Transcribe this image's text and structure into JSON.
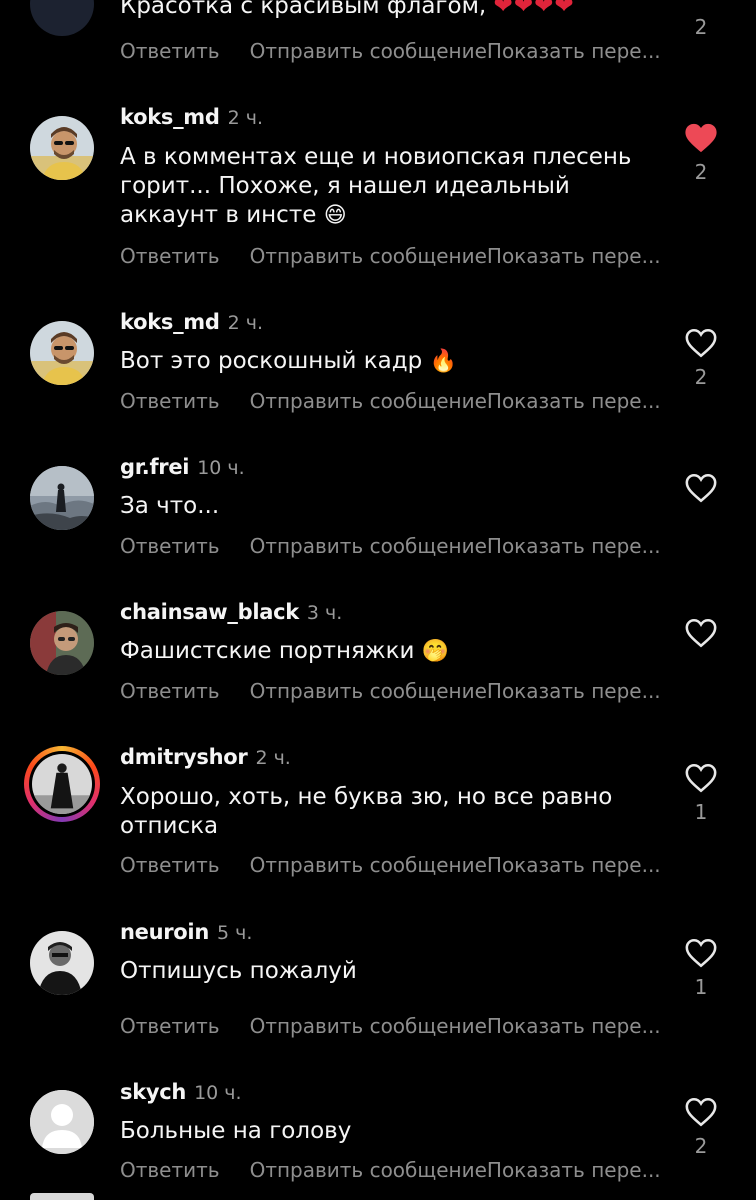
{
  "labels": {
    "reply": "Ответить",
    "send_message": "Отправить сообщение",
    "show_translation": "Показать пере..."
  },
  "colors": {
    "like_active": "#ed4956",
    "background": "#000000",
    "muted": "#8e8e8e"
  },
  "comments": [
    {
      "username": "",
      "time": "",
      "text": "Красотка с красивым флагом,",
      "emoji": "❤❤❤❤",
      "likes": "2",
      "liked": false
    },
    {
      "username": "koks_md",
      "time": "2 ч.",
      "text": "А в комментах еще и новиопская плесень горит... Похоже, я нашел идеальный аккаунт в инсте",
      "emoji": "😄",
      "likes": "2",
      "liked": true,
      "avatar_icon": "man-with-sunglasses-avatar"
    },
    {
      "username": "koks_md",
      "time": "2 ч.",
      "text": "Вот это роскошный кадр",
      "emoji": "🔥",
      "likes": "2",
      "liked": false,
      "avatar_icon": "man-with-sunglasses-avatar"
    },
    {
      "username": "gr.frei",
      "time": "10 ч.",
      "text": "За что...",
      "emoji": "",
      "likes": "",
      "liked": false,
      "avatar_icon": "wanderer-above-fog-avatar"
    },
    {
      "username": "chainsaw_black",
      "time": "3 ч.",
      "text": "Фашистские портняжки",
      "emoji": "🤭",
      "likes": "",
      "liked": false,
      "avatar_icon": "man-with-glasses-avatar"
    },
    {
      "username": "dmitryshor",
      "time": "2 ч.",
      "text": "Хорошо, хоть, не буква зю, но все равно отписка",
      "emoji": "",
      "likes": "1",
      "liked": false,
      "avatar_icon": "man-in-coat-story-avatar"
    },
    {
      "username": "neuroin",
      "time": "5 ч.",
      "text": "Отпишусь пожалуй",
      "emoji": "",
      "likes": "1",
      "liked": false,
      "avatar_icon": "bw-portrait-avatar"
    },
    {
      "username": "skych",
      "time": "10 ч.",
      "text": "Больные на голову",
      "emoji": "",
      "likes": "2",
      "liked": false,
      "avatar_icon": "default-user-avatar"
    }
  ]
}
